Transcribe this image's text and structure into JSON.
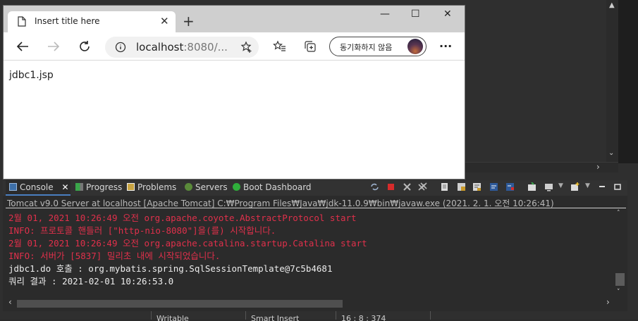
{
  "browser": {
    "tab_title": "Insert title here",
    "tab_close": "✕",
    "new_tab": "+",
    "win_min": "—",
    "win_max": "☐",
    "win_close": "✕",
    "address_host": "localhost",
    "address_rest": ":8080/...",
    "sync_label": "동기화하지 않음",
    "more": "···",
    "page_text": "jdbc1.jsp"
  },
  "console": {
    "tabs": [
      {
        "label": "Console",
        "icon": "console-icon"
      },
      {
        "label": "Progress",
        "icon": "progress-icon"
      },
      {
        "label": "Problems",
        "icon": "problems-icon"
      },
      {
        "label": "Servers",
        "icon": "servers-icon"
      },
      {
        "label": "Boot Dashboard",
        "icon": "boot-dashboard-icon"
      }
    ],
    "tab_close": "✕",
    "process": "Tomcat v9.0 Server at localhost [Apache Tomcat] C:₩Program Files₩Java₩jdk-11.0.9₩bin₩javaw.exe  (2021. 2. 1. 오전 10:26:41)",
    "lines": [
      {
        "text": "2월 01, 2021 10:26:49 오전 org.apache.coyote.AbstractProtocol start",
        "color": "red"
      },
      {
        "text": "INFO: 프로토콜 핸들러 [\"http-nio-8080\"]을(를) 시작합니다.",
        "color": "red"
      },
      {
        "text": "2월 01, 2021 10:26:49 오전 org.apache.catalina.startup.Catalina start",
        "color": "red"
      },
      {
        "text": "INFO: 서버가 [5837] 밀리초 내에 시작되었습니다.",
        "color": "red"
      },
      {
        "text": "jdbc1.do 호출 : org.mybatis.spring.SqlSessionTemplate@7c5b4681",
        "color": "white"
      },
      {
        "text": "쿼리 결과 : 2021-02-01 10:26:53.0",
        "color": "white"
      }
    ]
  },
  "status": {
    "writable": "Writable",
    "insert": "Smart Insert",
    "position": "16 : 8 : 374"
  },
  "colors": {
    "console_error": "#e0304b",
    "console_text": "#ececec",
    "ide_bg": "#2b2b2b"
  }
}
